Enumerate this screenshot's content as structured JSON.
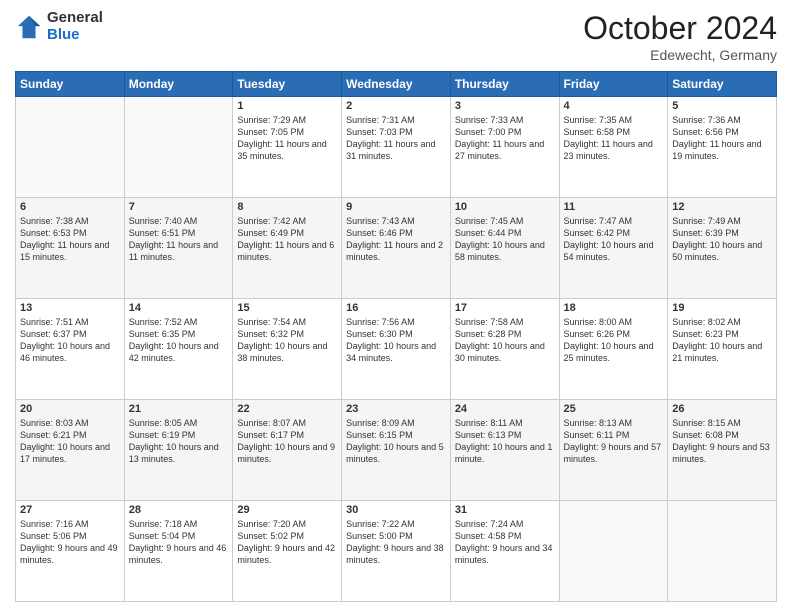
{
  "header": {
    "logo_general": "General",
    "logo_blue": "Blue",
    "month": "October 2024",
    "location": "Edewecht, Germany"
  },
  "weekdays": [
    "Sunday",
    "Monday",
    "Tuesday",
    "Wednesday",
    "Thursday",
    "Friday",
    "Saturday"
  ],
  "weeks": [
    [
      {
        "day": "",
        "sunrise": "",
        "sunset": "",
        "daylight": ""
      },
      {
        "day": "",
        "sunrise": "",
        "sunset": "",
        "daylight": ""
      },
      {
        "day": "1",
        "sunrise": "Sunrise: 7:29 AM",
        "sunset": "Sunset: 7:05 PM",
        "daylight": "Daylight: 11 hours and 35 minutes."
      },
      {
        "day": "2",
        "sunrise": "Sunrise: 7:31 AM",
        "sunset": "Sunset: 7:03 PM",
        "daylight": "Daylight: 11 hours and 31 minutes."
      },
      {
        "day": "3",
        "sunrise": "Sunrise: 7:33 AM",
        "sunset": "Sunset: 7:00 PM",
        "daylight": "Daylight: 11 hours and 27 minutes."
      },
      {
        "day": "4",
        "sunrise": "Sunrise: 7:35 AM",
        "sunset": "Sunset: 6:58 PM",
        "daylight": "Daylight: 11 hours and 23 minutes."
      },
      {
        "day": "5",
        "sunrise": "Sunrise: 7:36 AM",
        "sunset": "Sunset: 6:56 PM",
        "daylight": "Daylight: 11 hours and 19 minutes."
      }
    ],
    [
      {
        "day": "6",
        "sunrise": "Sunrise: 7:38 AM",
        "sunset": "Sunset: 6:53 PM",
        "daylight": "Daylight: 11 hours and 15 minutes."
      },
      {
        "day": "7",
        "sunrise": "Sunrise: 7:40 AM",
        "sunset": "Sunset: 6:51 PM",
        "daylight": "Daylight: 11 hours and 11 minutes."
      },
      {
        "day": "8",
        "sunrise": "Sunrise: 7:42 AM",
        "sunset": "Sunset: 6:49 PM",
        "daylight": "Daylight: 11 hours and 6 minutes."
      },
      {
        "day": "9",
        "sunrise": "Sunrise: 7:43 AM",
        "sunset": "Sunset: 6:46 PM",
        "daylight": "Daylight: 11 hours and 2 minutes."
      },
      {
        "day": "10",
        "sunrise": "Sunrise: 7:45 AM",
        "sunset": "Sunset: 6:44 PM",
        "daylight": "Daylight: 10 hours and 58 minutes."
      },
      {
        "day": "11",
        "sunrise": "Sunrise: 7:47 AM",
        "sunset": "Sunset: 6:42 PM",
        "daylight": "Daylight: 10 hours and 54 minutes."
      },
      {
        "day": "12",
        "sunrise": "Sunrise: 7:49 AM",
        "sunset": "Sunset: 6:39 PM",
        "daylight": "Daylight: 10 hours and 50 minutes."
      }
    ],
    [
      {
        "day": "13",
        "sunrise": "Sunrise: 7:51 AM",
        "sunset": "Sunset: 6:37 PM",
        "daylight": "Daylight: 10 hours and 46 minutes."
      },
      {
        "day": "14",
        "sunrise": "Sunrise: 7:52 AM",
        "sunset": "Sunset: 6:35 PM",
        "daylight": "Daylight: 10 hours and 42 minutes."
      },
      {
        "day": "15",
        "sunrise": "Sunrise: 7:54 AM",
        "sunset": "Sunset: 6:32 PM",
        "daylight": "Daylight: 10 hours and 38 minutes."
      },
      {
        "day": "16",
        "sunrise": "Sunrise: 7:56 AM",
        "sunset": "Sunset: 6:30 PM",
        "daylight": "Daylight: 10 hours and 34 minutes."
      },
      {
        "day": "17",
        "sunrise": "Sunrise: 7:58 AM",
        "sunset": "Sunset: 6:28 PM",
        "daylight": "Daylight: 10 hours and 30 minutes."
      },
      {
        "day": "18",
        "sunrise": "Sunrise: 8:00 AM",
        "sunset": "Sunset: 6:26 PM",
        "daylight": "Daylight: 10 hours and 25 minutes."
      },
      {
        "day": "19",
        "sunrise": "Sunrise: 8:02 AM",
        "sunset": "Sunset: 6:23 PM",
        "daylight": "Daylight: 10 hours and 21 minutes."
      }
    ],
    [
      {
        "day": "20",
        "sunrise": "Sunrise: 8:03 AM",
        "sunset": "Sunset: 6:21 PM",
        "daylight": "Daylight: 10 hours and 17 minutes."
      },
      {
        "day": "21",
        "sunrise": "Sunrise: 8:05 AM",
        "sunset": "Sunset: 6:19 PM",
        "daylight": "Daylight: 10 hours and 13 minutes."
      },
      {
        "day": "22",
        "sunrise": "Sunrise: 8:07 AM",
        "sunset": "Sunset: 6:17 PM",
        "daylight": "Daylight: 10 hours and 9 minutes."
      },
      {
        "day": "23",
        "sunrise": "Sunrise: 8:09 AM",
        "sunset": "Sunset: 6:15 PM",
        "daylight": "Daylight: 10 hours and 5 minutes."
      },
      {
        "day": "24",
        "sunrise": "Sunrise: 8:11 AM",
        "sunset": "Sunset: 6:13 PM",
        "daylight": "Daylight: 10 hours and 1 minute."
      },
      {
        "day": "25",
        "sunrise": "Sunrise: 8:13 AM",
        "sunset": "Sunset: 6:11 PM",
        "daylight": "Daylight: 9 hours and 57 minutes."
      },
      {
        "day": "26",
        "sunrise": "Sunrise: 8:15 AM",
        "sunset": "Sunset: 6:08 PM",
        "daylight": "Daylight: 9 hours and 53 minutes."
      }
    ],
    [
      {
        "day": "27",
        "sunrise": "Sunrise: 7:16 AM",
        "sunset": "Sunset: 5:06 PM",
        "daylight": "Daylight: 9 hours and 49 minutes."
      },
      {
        "day": "28",
        "sunrise": "Sunrise: 7:18 AM",
        "sunset": "Sunset: 5:04 PM",
        "daylight": "Daylight: 9 hours and 46 minutes."
      },
      {
        "day": "29",
        "sunrise": "Sunrise: 7:20 AM",
        "sunset": "Sunset: 5:02 PM",
        "daylight": "Daylight: 9 hours and 42 minutes."
      },
      {
        "day": "30",
        "sunrise": "Sunrise: 7:22 AM",
        "sunset": "Sunset: 5:00 PM",
        "daylight": "Daylight: 9 hours and 38 minutes."
      },
      {
        "day": "31",
        "sunrise": "Sunrise: 7:24 AM",
        "sunset": "Sunset: 4:58 PM",
        "daylight": "Daylight: 9 hours and 34 minutes."
      },
      {
        "day": "",
        "sunrise": "",
        "sunset": "",
        "daylight": ""
      },
      {
        "day": "",
        "sunrise": "",
        "sunset": "",
        "daylight": ""
      }
    ]
  ]
}
